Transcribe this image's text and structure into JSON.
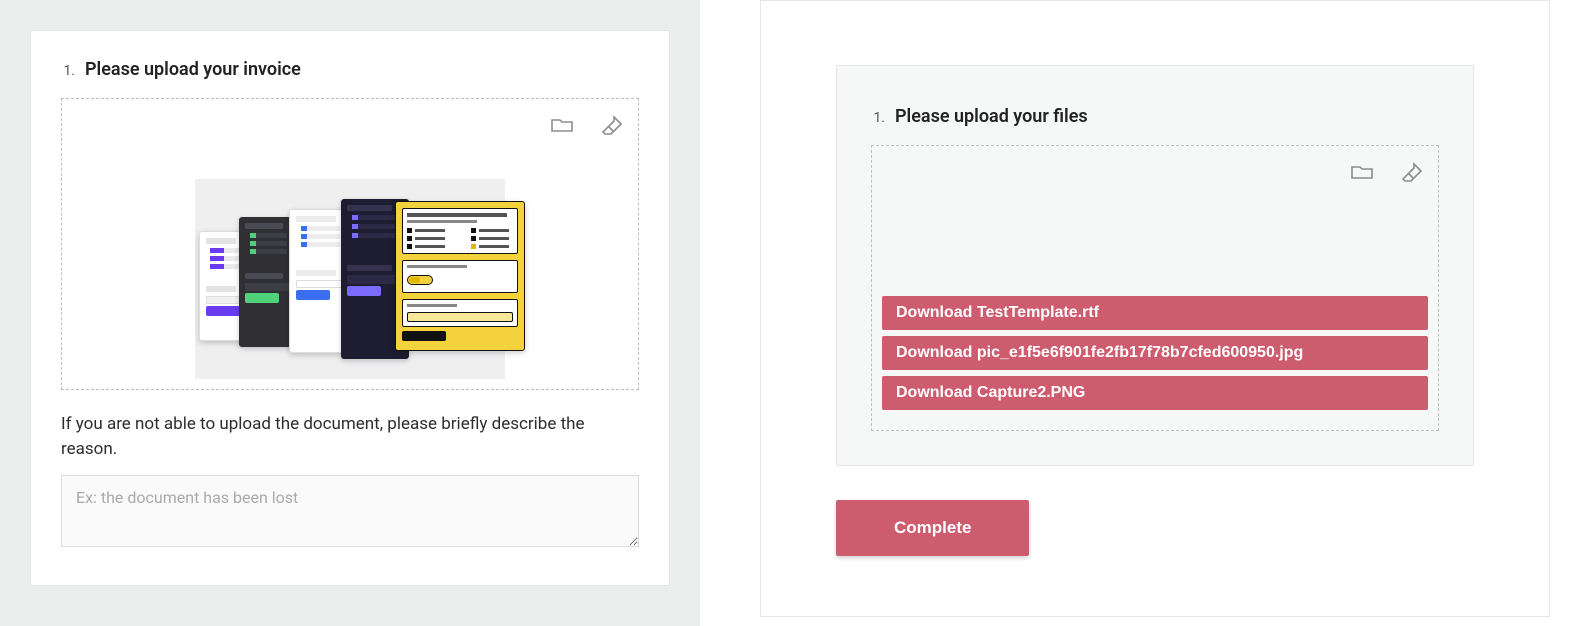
{
  "left": {
    "question_number": "1.",
    "question_text": "Please upload your invoice",
    "fallback_label": "If you are not able to upload the document, please briefly describe the reason.",
    "textarea_placeholder": "Ex: the document has been lost"
  },
  "right": {
    "question_number": "1.",
    "question_text": "Please upload your files",
    "files": [
      "Download TestTemplate.rtf",
      "Download pic_e1f5e6f901fe2fb17f78b7cfed600950.jpg",
      "Download Capture2.PNG"
    ],
    "complete_label": "Complete"
  },
  "colors": {
    "accent": "#cd5c6e"
  }
}
